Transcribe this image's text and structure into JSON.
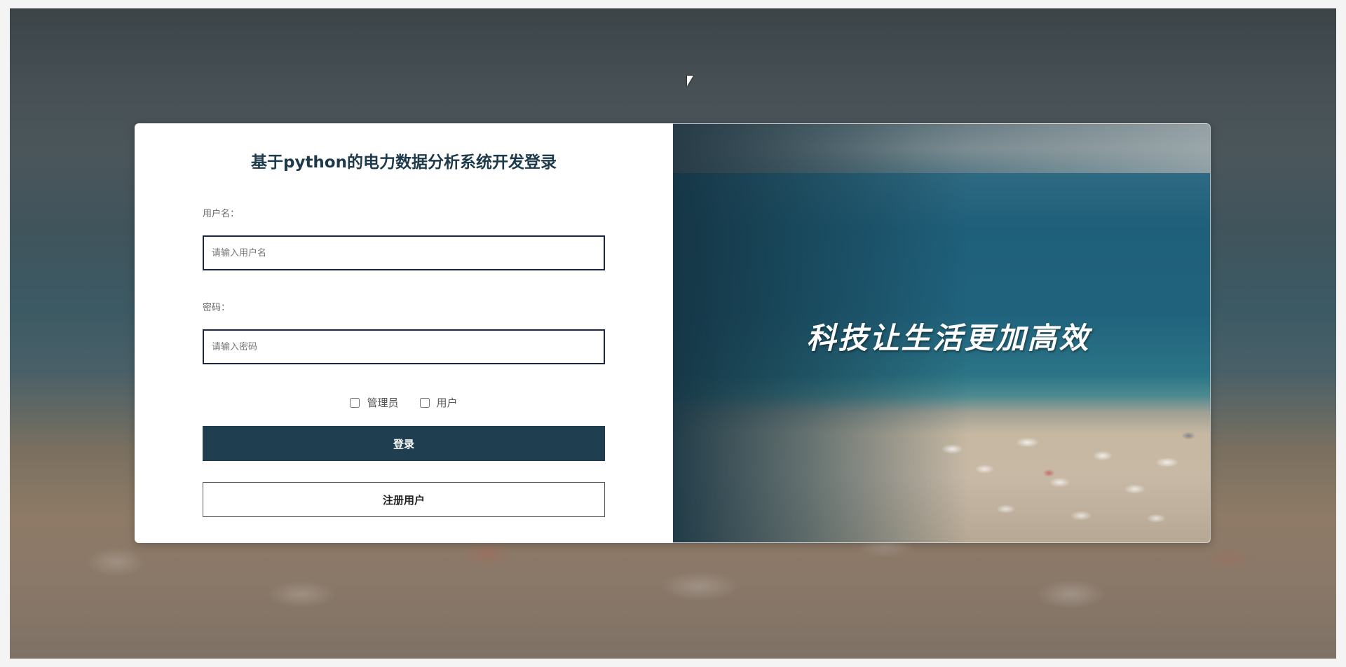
{
  "login": {
    "title": "基于python的电力数据分析系统开发登录",
    "username": {
      "label": "用户名：",
      "placeholder": "请输入用户名",
      "value": ""
    },
    "password": {
      "label": "密码：",
      "placeholder": "请输入密码",
      "value": ""
    },
    "roles": [
      {
        "label": "管理员",
        "checked": false
      },
      {
        "label": "用户",
        "checked": false
      }
    ],
    "login_button": "登录",
    "register_button": "注册用户"
  },
  "banner": {
    "slogan": "科技让生活更加高效"
  },
  "colors": {
    "accent": "#1f3e4f",
    "input_border": "#1b2640",
    "title": "#1e3a4a"
  }
}
